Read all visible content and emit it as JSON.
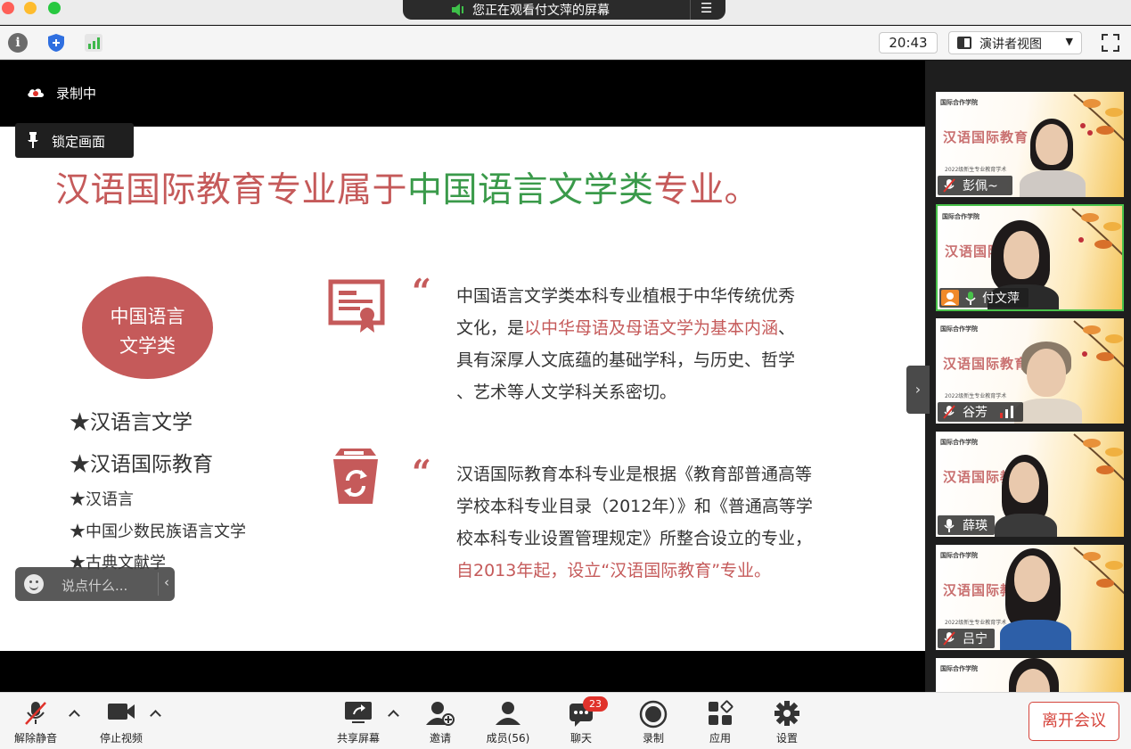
{
  "window": {
    "share_banner": "您正在观看付文萍的屏幕",
    "clock": "20:43",
    "view_mode": "演讲者视图"
  },
  "recording": {
    "label": "录制中"
  },
  "lock_tooltip": "锁定画面",
  "chat_input": {
    "placeholder": "说点什么..."
  },
  "slide": {
    "title_part1": "汉语国际教育专业属于",
    "title_part2": "中国语言文学类",
    "title_part3": "专业。",
    "category_line1": "中国语言",
    "category_line2": "文学类",
    "items": [
      "★汉语言文学",
      "★汉语国际教育",
      "★汉语言",
      "★中国少数民族语言文学",
      "★古典文献学"
    ],
    "quote_mark": "“",
    "para1": {
      "line1": "中国语言文学类本科专业植根于中华传统优秀",
      "line2a": "文化，是",
      "line2b": "以中华母语及母语文学为基本内涵",
      "line2c": "、",
      "line3": "具有深厚人文底蕴的基础学科，与历史、哲学",
      "line4": "、艺术等人文学科关系密切。"
    },
    "para2": {
      "line1": "汉语国际教育本科专业是根据《教育部普通高等",
      "line2": "学校本科专业目录（2012年）》和《普通高等学",
      "line3": "校本科专业设置管理规定》所整合设立的专业，",
      "line4": "自2013年起，设立“汉语国际教育”专业。"
    }
  },
  "gallery": {
    "school_label": "国际合作学院",
    "tile_title": "汉语国际教育",
    "tile_subtitle": "2022级新生专业教育学术",
    "participants": [
      {
        "name": "彭佩~",
        "muted": true
      },
      {
        "name": "付文萍",
        "muted": false,
        "active": true
      },
      {
        "name": "谷芳",
        "muted": true
      },
      {
        "name": "薛瑛",
        "muted": false
      },
      {
        "name": "吕宁",
        "muted": true
      }
    ]
  },
  "controls": {
    "unmute": "解除静音",
    "stop_video": "停止视频",
    "share_screen": "共享屏幕",
    "invite": "邀请",
    "members": "成员(56)",
    "chat": "聊天",
    "chat_badge": "23",
    "record": "录制",
    "apps": "应用",
    "settings": "设置",
    "leave": "离开会议"
  },
  "colors": {
    "accent_red": "#c55a5a",
    "accent_green": "#3a9a4a",
    "active_border": "#48c24a",
    "leave_red": "#d6453d"
  }
}
